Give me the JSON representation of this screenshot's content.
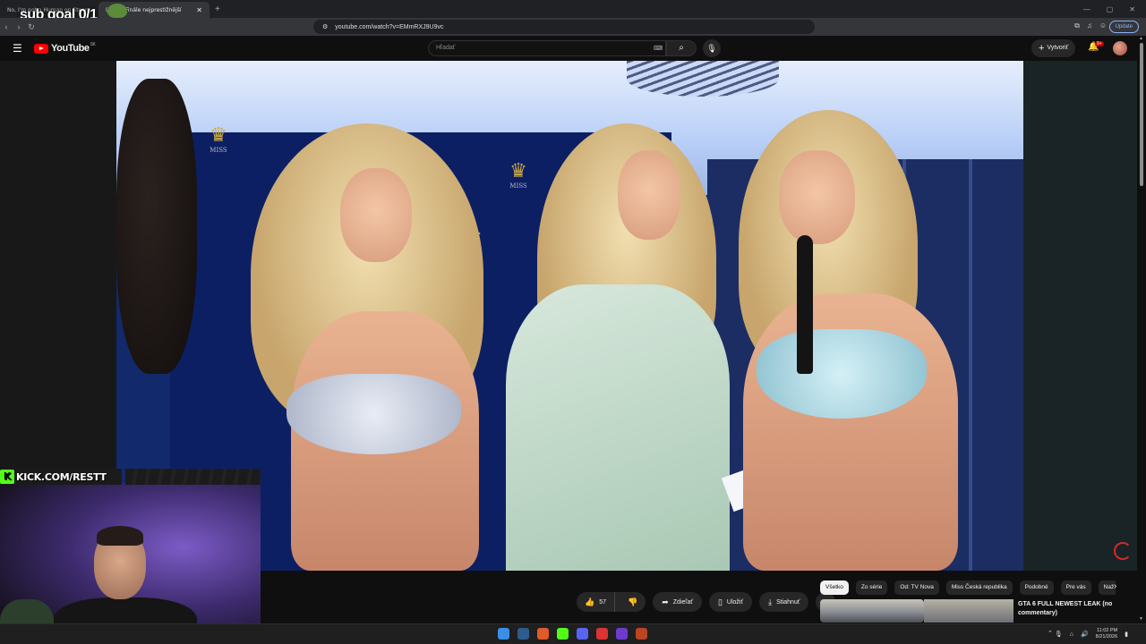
{
  "overlay": {
    "sub_goal": "sub goal 0/1",
    "kick": "KICK.COM/RESTT",
    "kick_letter": "K"
  },
  "browser": {
    "tabs": [
      {
        "title": "No, I'm not a Human on Steam",
        "active": false
      },
      {
        "title": "(1487) Finále nejprestižnější",
        "active": true
      }
    ],
    "url": "youtube.com/watch?v=EMmRXJ9U9vc",
    "update_label": "Update"
  },
  "youtube": {
    "logo": "YouTube",
    "region": "SK",
    "search_placeholder": "Hľadať",
    "create_label": "Vytvoriť",
    "notif_count": "9+"
  },
  "actions": {
    "likes": "57",
    "share": "Zdieľať",
    "save": "Uložiť",
    "download": "Stiahnuť"
  },
  "chips": [
    "Všetko",
    "Zo série",
    "Od: TV Nova",
    "Miss Česká republika",
    "Podobné",
    "Pre vás",
    "Naž"
  ],
  "recommendation": {
    "title": "GTA 6 FULL NEWEST LEAK (no commentary)"
  },
  "taskbar": {
    "time": "11:02 PM",
    "date": "8/21/2026"
  },
  "video": {
    "crown_text": "MISS"
  },
  "colors": {
    "youtube_red": "#ff0000",
    "kick_green": "#53fc18",
    "update_blue": "#8ab4f8"
  }
}
